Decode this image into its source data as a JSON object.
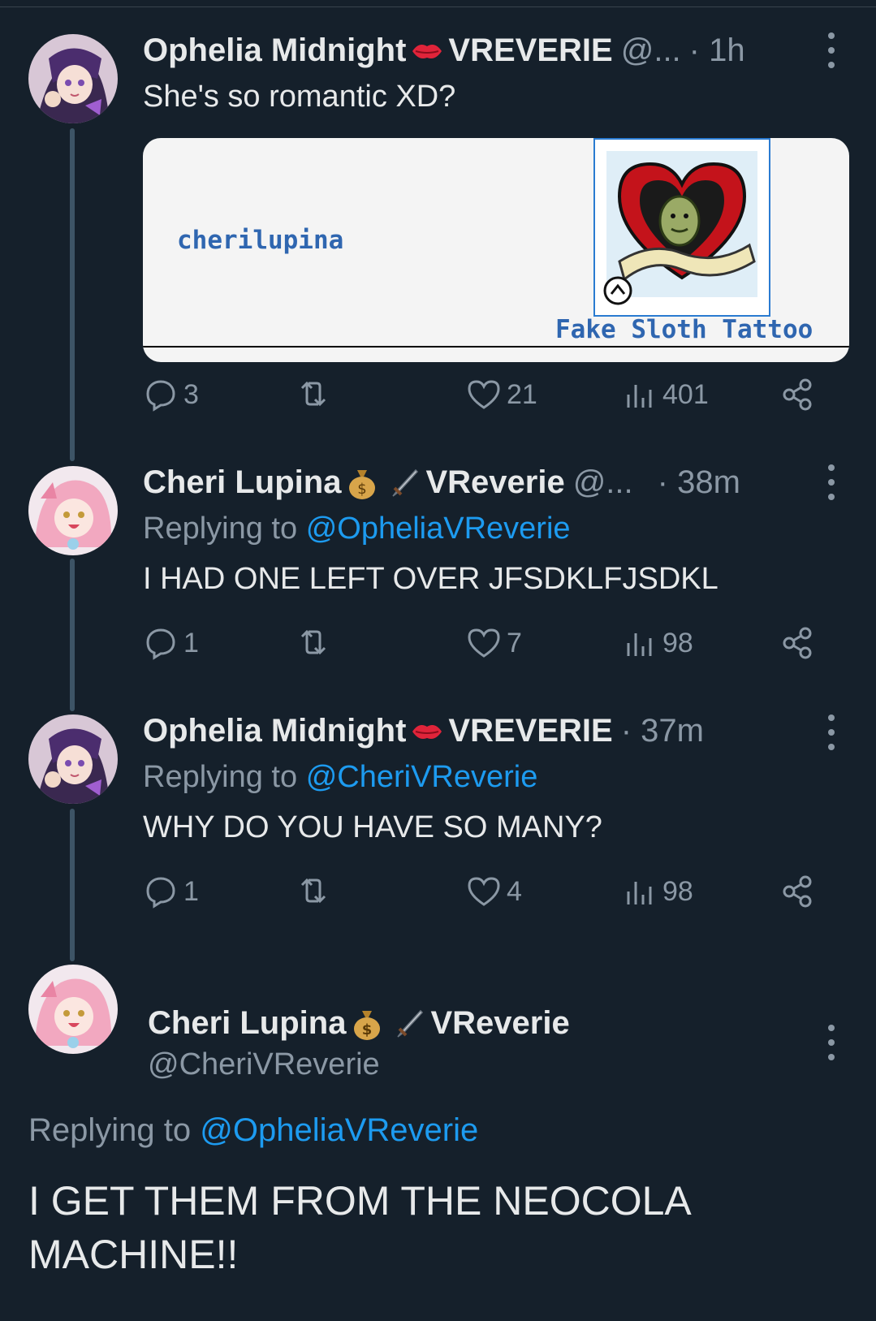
{
  "tweets": [
    {
      "name": "Ophelia Midnight",
      "badge_icon": "lips-emoji",
      "name_suffix": "VREVERIE",
      "handle": "@...",
      "time": "· 1h",
      "text": "She's so romantic XD?",
      "card": {
        "user": "cherilupina",
        "caption": "Fake Sloth Tattoo",
        "image": "sloth-heart-tattoo"
      },
      "stats": {
        "replies": "3",
        "retweets": "",
        "likes": "21",
        "views": "401"
      }
    },
    {
      "name": "Cheri Lupina",
      "badge_icons": [
        "money-bag-emoji",
        "dagger-emoji"
      ],
      "name_suffix": "VReverie",
      "handle": "@...",
      "time": "· 38m",
      "replying_prefix": "Replying to",
      "replying_to": "@OpheliaVReverie",
      "text": "I HAD ONE LEFT OVER JFSDKLFJSDKL",
      "stats": {
        "replies": "1",
        "retweets": "",
        "likes": "7",
        "views": "98"
      }
    },
    {
      "name": "Ophelia Midnight",
      "badge_icon": "lips-emoji",
      "name_suffix": "VREVERIE",
      "time": "· 37m",
      "replying_prefix": "Replying to",
      "replying_to": "@CheriVReverie",
      "text": "WHY DO YOU HAVE SO MANY?",
      "stats": {
        "replies": "1",
        "retweets": "",
        "likes": "4",
        "views": "98"
      }
    }
  ],
  "main_tweet": {
    "name": "Cheri Lupina",
    "badge_icons": [
      "money-bag-emoji",
      "dagger-emoji"
    ],
    "name_suffix": "VReverie",
    "handle": "@CheriVReverie",
    "replying_prefix": "Replying to",
    "replying_to": "@OpheliaVReverie",
    "text": "I GET THEM FROM THE NEOCOLA MACHINE!!"
  },
  "colors": {
    "background": "#15202b",
    "text": "#e7e9ea",
    "muted": "#8b98a5",
    "accent": "#1d9bf0"
  }
}
